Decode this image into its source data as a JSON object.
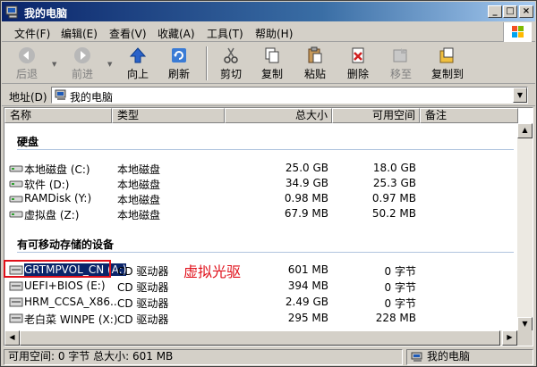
{
  "window": {
    "title": "我的电脑"
  },
  "titlebar_buttons": {
    "minimize": "_",
    "maximize": "□",
    "close": "×"
  },
  "menu": [
    "文件(F)",
    "编辑(E)",
    "查看(V)",
    "收藏(A)",
    "工具(T)",
    "帮助(H)"
  ],
  "toolbar": {
    "back": "后退",
    "forward": "前进",
    "up": "向上",
    "refresh": "刷新",
    "cut": "剪切",
    "copy": "复制",
    "paste": "粘贴",
    "delete": "删除",
    "moveto": "移至",
    "copyto": "复制到"
  },
  "address": {
    "label": "地址(D)",
    "value": "我的电脑",
    "icon": "computer-icon"
  },
  "columns": [
    "名称",
    "类型",
    "总大小",
    "可用空间",
    "备注"
  ],
  "groups": {
    "harddisk": "硬盘",
    "removable": "有可移动存储的设备"
  },
  "drives": [
    {
      "name": "本地磁盘 (C:)",
      "type": "本地磁盘",
      "total": "25.0 GB",
      "free": "18.0 GB",
      "icon": "hard-drive-icon"
    },
    {
      "name": "软件 (D:)",
      "type": "本地磁盘",
      "total": "34.9 GB",
      "free": "25.3 GB",
      "icon": "hard-drive-icon"
    },
    {
      "name": "RAMDisk (Y:)",
      "type": "本地磁盘",
      "total": "0.98 MB",
      "free": "0.97 MB",
      "icon": "hard-drive-icon"
    },
    {
      "name": "虚拟盘 (Z:)",
      "type": "本地磁盘",
      "total": "67.9 MB",
      "free": "50.2 MB",
      "icon": "hard-drive-icon"
    }
  ],
  "removable": [
    {
      "name": "GRTMPVOL_CN (A:)",
      "type": "CD 驱动器",
      "total": "601 MB",
      "free": "0 字节",
      "icon": "cd-drive-icon",
      "selected": true
    },
    {
      "name": "UEFI+BIOS (E:)",
      "type": "CD 驱动器",
      "total": "394 MB",
      "free": "0 字节",
      "icon": "cd-drive-icon"
    },
    {
      "name": "HRM_CCSA_X86...",
      "type": "CD 驱动器",
      "total": "2.49 GB",
      "free": "0 字节",
      "icon": "cd-drive-icon"
    },
    {
      "name": "老白菜 WINPE (X:)",
      "type": "CD 驱动器",
      "total": "295 MB",
      "free": "228 MB",
      "icon": "cd-drive-icon"
    }
  ],
  "annotation": "虚拟光驱",
  "status": {
    "left": "可用空间: 0 字节 总大小: 601 MB",
    "right": "我的电脑"
  },
  "colors": {
    "titlebar": "#0a246a",
    "selection": "#0a246a",
    "annotation": "#e0101a"
  }
}
